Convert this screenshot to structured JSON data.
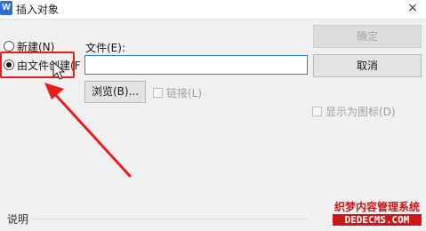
{
  "window": {
    "title": "插入对象",
    "app_icon": "W",
    "close_glyph": "×"
  },
  "options": {
    "new_label": "新建(N)",
    "from_file_label": "由文件创建(F",
    "selected": "from_file"
  },
  "file": {
    "label": "文件(E):",
    "value": "",
    "placeholder": ""
  },
  "buttons": {
    "ok": "确定",
    "cancel": "取消",
    "browse": "浏览(B)..."
  },
  "checks": {
    "link": "链接(L)",
    "display_as_icon": "显示为图标(D)"
  },
  "note": {
    "label": "说明"
  },
  "watermark": {
    "top": "织梦内容管理系统",
    "bottom": "DEDECMS.COM"
  },
  "colors": {
    "highlight": "#e61e1e",
    "accent": "#2f7fd7",
    "watermark": "#c8191b"
  },
  "icons": {
    "app": "wps-writer-icon",
    "cursor": "mouse-pointer-icon",
    "annotation": "red-arrow-icon"
  }
}
